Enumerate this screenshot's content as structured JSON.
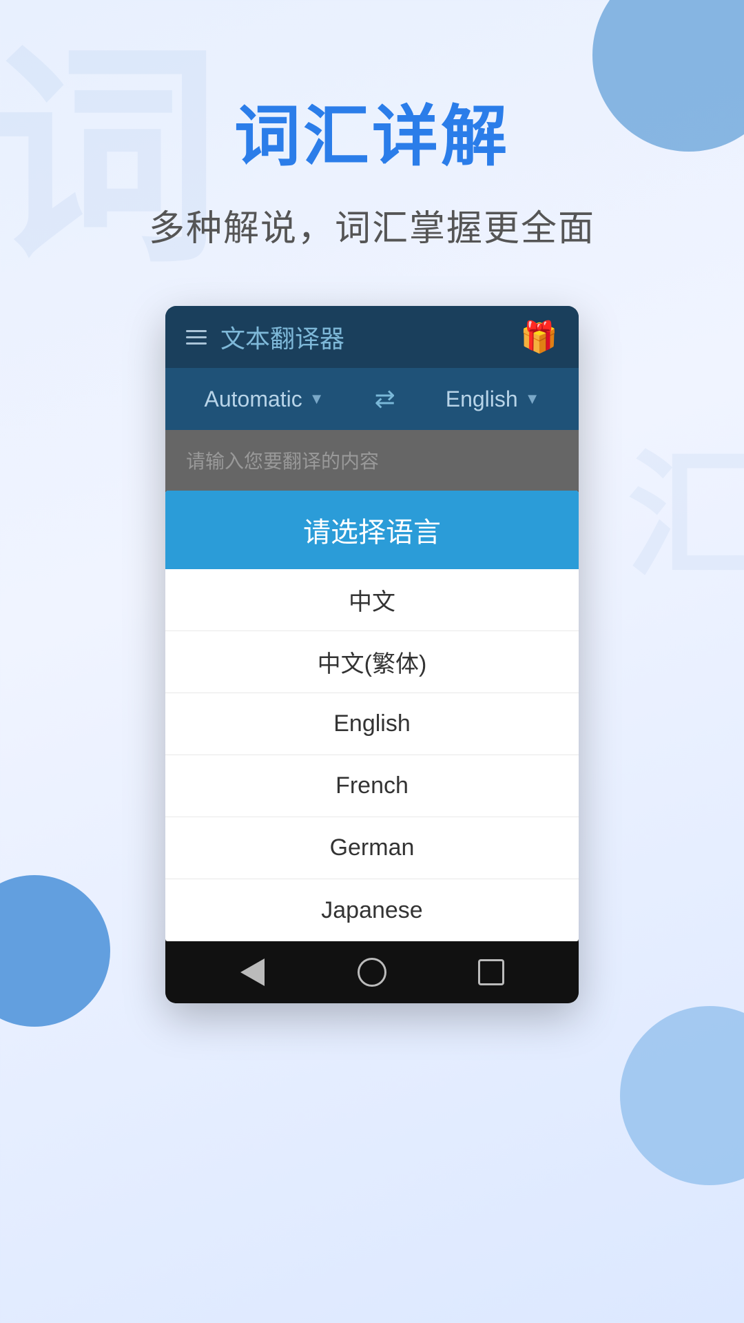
{
  "page": {
    "background_colors": {
      "main": "#e8f0fe",
      "accent": "#2b7de9"
    }
  },
  "header": {
    "main_title": "词汇详解",
    "sub_title": "多种解说，词汇掌握更全面"
  },
  "app": {
    "topbar": {
      "title": "文本翻译器",
      "gift_icon": "🎁"
    },
    "lang_bar": {
      "source_lang": "Automatic",
      "target_lang": "English",
      "swap_symbol": "⇄"
    },
    "input_placeholder": "请输入您要翻译的内容"
  },
  "dialog": {
    "title": "请选择语言",
    "items": [
      {
        "label": "中文"
      },
      {
        "label": "中文(繁体)"
      },
      {
        "label": "English"
      },
      {
        "label": "French"
      },
      {
        "label": "German"
      },
      {
        "label": "Japanese"
      }
    ]
  },
  "bottom_nav": {
    "back_label": "back",
    "home_label": "home",
    "recent_label": "recent"
  }
}
